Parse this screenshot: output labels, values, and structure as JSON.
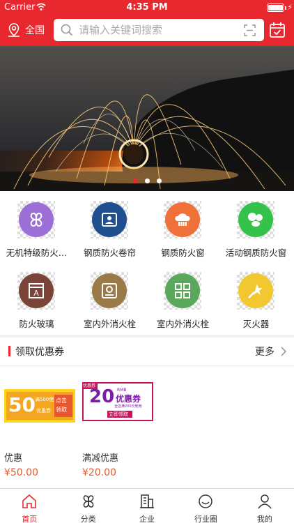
{
  "status_bar": {
    "carrier": "Carrier",
    "time": "4:35 PM"
  },
  "header": {
    "location_label": "全国",
    "search_placeholder": "请输入关键词搜索"
  },
  "banner": {
    "slide_count": 3,
    "active_index": 0
  },
  "categories": [
    {
      "label": "无机特级防火…",
      "icon": "clover-icon",
      "color": "#9b6fd6"
    },
    {
      "label": "钢质防火卷帘",
      "icon": "contact-card-icon",
      "color": "#1f4f8f"
    },
    {
      "label": "钢质防火窗",
      "icon": "chef-hat-icon",
      "color": "#f0703a"
    },
    {
      "label": "活动钢质防火窗",
      "icon": "pills-icon",
      "color": "#35c24a"
    },
    {
      "label": "防火玻璃",
      "icon": "text-frame-icon",
      "color": "#7a4438"
    },
    {
      "label": "室内外消火栓",
      "icon": "badge-frame-icon",
      "color": "#9a7a48"
    },
    {
      "label": "室内外消火栓",
      "icon": "grid-icon",
      "color": "#5aa85c"
    },
    {
      "label": "灭火器",
      "icon": "magic-star-icon",
      "color": "#f2c830"
    }
  ],
  "coupon_section": {
    "title": "领取优惠券",
    "more_label": "更多",
    "items": [
      {
        "name": "优惠",
        "price": "¥50.00",
        "image_text": {
          "amount": "50",
          "small": "满500使用",
          "tag": "优惠券",
          "cta_1": "点击",
          "cta_2": "领取"
        }
      },
      {
        "name": "满减优惠",
        "price": "¥20.00",
        "image_text": {
          "amount": "20",
          "currency": "RMB",
          "title": "优惠券",
          "note": "全店满200元使用",
          "cta": "立即领取",
          "ribbon": "优惠券"
        }
      }
    ]
  },
  "tab_bar": {
    "active": 0,
    "tabs": [
      {
        "label": "首页",
        "icon": "home-icon"
      },
      {
        "label": "分类",
        "icon": "category-icon"
      },
      {
        "label": "企业",
        "icon": "building-icon"
      },
      {
        "label": "行业圈",
        "icon": "smiley-icon"
      },
      {
        "label": "我的",
        "icon": "user-icon"
      }
    ]
  },
  "colors": {
    "brand": "#e8272e",
    "price": "#e8572e"
  }
}
